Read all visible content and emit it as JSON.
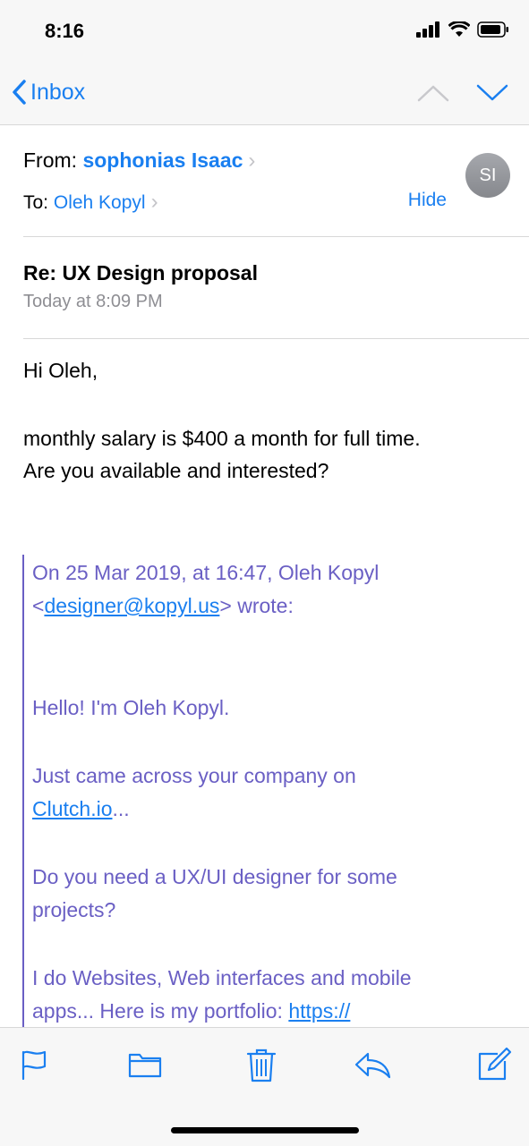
{
  "status_bar": {
    "time": "8:16"
  },
  "nav": {
    "back_label": "Inbox"
  },
  "header": {
    "from_label": "From:",
    "from_name": "sophonias Isaac",
    "to_label": "To:",
    "to_name": "Oleh Kopyl",
    "hide_label": "Hide",
    "avatar_initials": "SI"
  },
  "message": {
    "subject": "Re: UX Design proposal",
    "date": "Today at 8:09 PM",
    "greeting": "Hi Oleh,",
    "line1": "monthly salary is $400 a month for full time.",
    "line2": "Are you available and interested?"
  },
  "quote": {
    "intro_line1": "On 25 Mar 2019, at 16:47, Oleh Kopyl",
    "email_prefix": "<",
    "email_link": "designer@kopyl.us",
    "email_suffix": "> wrote:",
    "p1": "Hello! I'm Oleh Kopyl.",
    "p2_line1": "Just came across your company on",
    "p2_link": "Clutch.io",
    "p2_suffix": "...",
    "p3_line1": "Do you need a UX/UI designer for some",
    "p3_line2": "projects?",
    "p4_line1": "I do Websites, Web interfaces and mobile",
    "p4_line2_text": "apps... Here is my portfolio: ",
    "p4_link": "https://"
  },
  "colors": {
    "accent": "#1a7ff0",
    "quote": "#6a5fc4"
  },
  "toolbar": {
    "icons": [
      "flag-icon",
      "folder-icon",
      "trash-icon",
      "reply-icon",
      "compose-icon"
    ]
  }
}
